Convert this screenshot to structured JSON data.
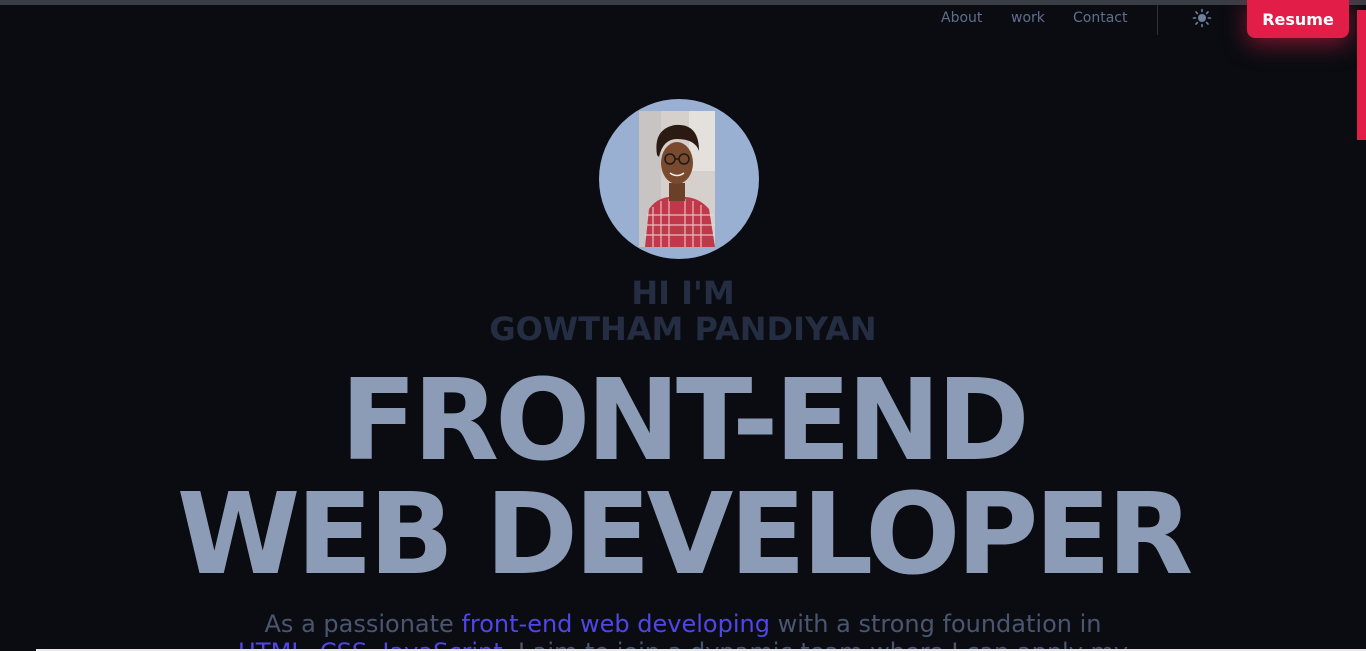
{
  "nav": {
    "links": [
      "About",
      "work",
      "Contact"
    ],
    "theme_icon": "sun-icon",
    "resume_label": "Resume"
  },
  "hero": {
    "greeting_line1": "HI I'M",
    "greeting_line2": "GOWTHAM PANDIYAN",
    "headline_line1": "FRONT-END",
    "headline_line2": "WEB DEVELOPER",
    "intro": {
      "part1": "As a passionate ",
      "highlight1": "front-end web developing",
      "part2": " with a strong foundation in",
      "highlight2": "HTML, CSS, JavaScript",
      "part3": ", I aim to join a dynamic team where I can apply my"
    }
  },
  "colors": {
    "background": "#0a0c12",
    "accent": "#e11d48",
    "highlight": "#4f46e5",
    "headline": "#8d9cb6"
  }
}
